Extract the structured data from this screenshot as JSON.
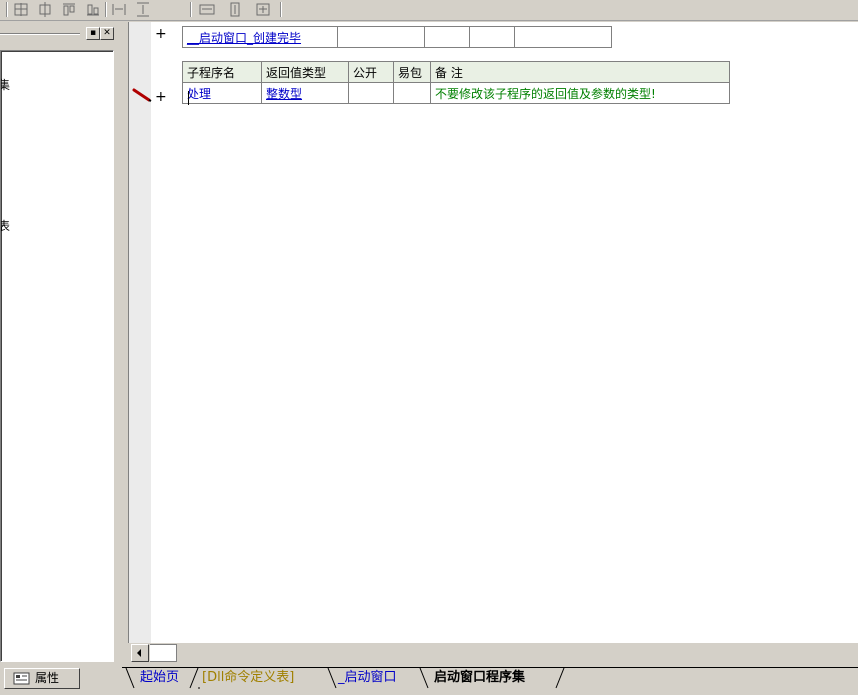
{
  "panel": {
    "tree_item_1": "集",
    "tree_item_2": "表"
  },
  "properties_tab": "属性",
  "editor": {
    "program_set_name": "__启动窗口_创建完毕",
    "header": {
      "name": "子程序名",
      "return_type": "返回值类型",
      "public": "公开",
      "easy_package": "易包",
      "remark": "备 注"
    },
    "row": {
      "name": "处理",
      "return_type": "整数型",
      "public": "",
      "easy_package": "",
      "remark": "不要修改该子程序的返回值及参数的类型!"
    },
    "plus": "+"
  },
  "tabs": [
    {
      "label": "起始页",
      "color": "#0000c8"
    },
    {
      "label": "[Dll命令定义表]",
      "color": "#a08000"
    },
    {
      "label": "_启动窗口",
      "color": "#0000c8"
    },
    {
      "label": "启动窗口程序集",
      "color": "#000000"
    }
  ],
  "colors": {
    "header_bg": "#e9f0e4",
    "type_blue": "#0000c8",
    "remark_green": "#008000"
  }
}
